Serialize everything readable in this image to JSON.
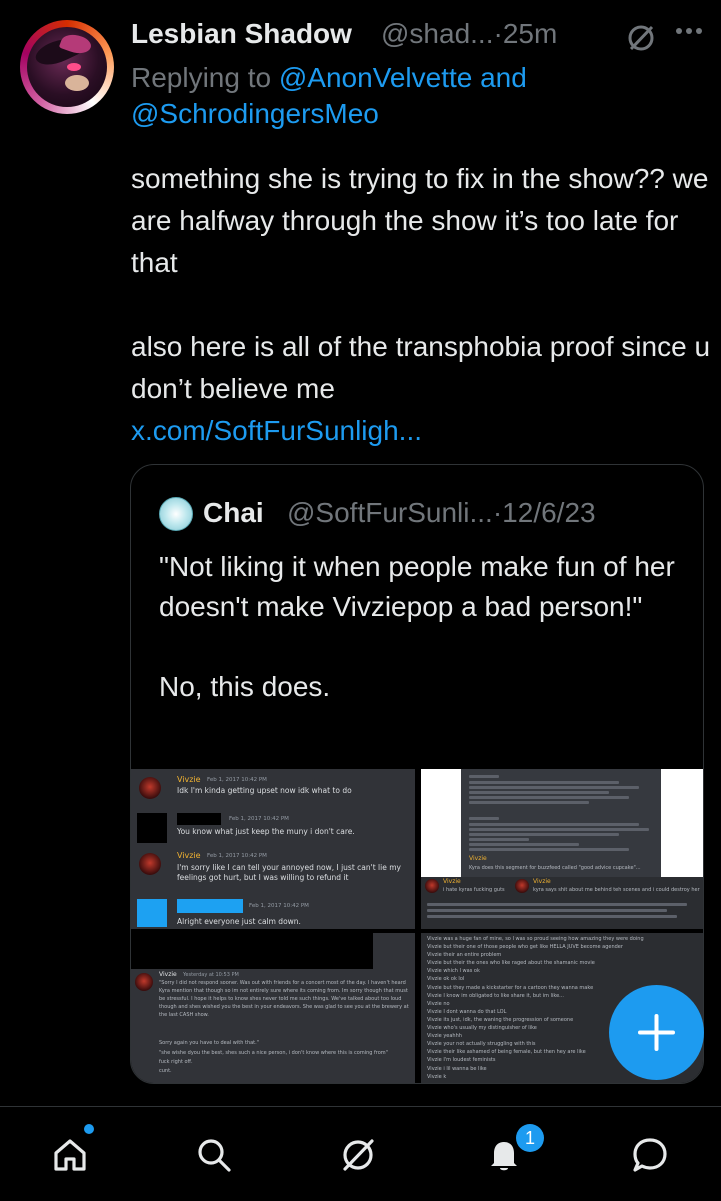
{
  "post": {
    "author_name": "Lesbian Shadow",
    "author_handle": "@shad...",
    "separator": "·",
    "time": "25m",
    "more_label": "···",
    "reply_prefix": "Replying to ",
    "reply_users": "@AnonVelvette and @SchrodingersMeo",
    "text_para1": "something she is trying to fix in the show?? we are halfway through the show it’s too late for that",
    "text_para2": "also here is all of the transphobia proof since u don’t believe me",
    "link": "x.com/SoftFurSunligh..."
  },
  "quote": {
    "author_name": "Chai",
    "author_handle": "@SoftFurSunli...",
    "separator": "·",
    "date": "12/6/23",
    "text_para1": "\"Not liking it when people make fun of her doesn't make Vivziepop a bad person!\"",
    "text_para2": "No, this does.",
    "images": {
      "img1": {
        "msg1_name": "Vivzie",
        "msg1_date": "Feb 1, 2017 10:42 PM",
        "msg1_text": "Idk I'm kinda getting upset now idk what to do",
        "msg2_date": "Feb 1, 2017 10:42 PM",
        "msg2_text": "You know what just keep the muny i don't care.",
        "msg3_name": "Vivzie",
        "msg3_date": "Feb 1, 2017 10:42 PM",
        "msg3_text": "I'm sorry like I can tell your annoyed now, I just can't lie my feelings got hurt, but I was willing to refund it",
        "msg4_date": "Feb 1, 2017 10:42 PM",
        "msg4_text": "Alright everyone just calm down."
      },
      "img2": {
        "name_a": "Vivzie",
        "text_a": "Kyra does this segment for buzzfeed called \"good advice cupcake\"...",
        "name_b": "Vivzie",
        "text_b": "i hate kyras fucking guts",
        "name_c": "Vivzie",
        "text_c": "kyra says shit about me behind teh scenes and i could destroy her"
      },
      "img3": {
        "name": "Vivzie",
        "date": "Yesterday at 10:53 PM",
        "text1": "\"Sorry I did not respond sooner. Was out with friends for a concert most of the day. I haven't heard Kyra mention that though so im not entirely sure where its coming from. Im sorry though that must be stressful. I hope it helps to know shes never told me such things. We've talked about too loud though and shes wished you the best in your endeavors. She was glad to see you at the brewery at the last CASH show.",
        "text2": "Sorry again you have to deal with that.\"",
        "text3": "\"she wishe dyou the best, shes such a nice person, i don't know where this is coming from\"",
        "text4": "fuck right off.",
        "text5": "cunt."
      },
      "img4": {
        "lines": [
          "Vivzie  was a huge fan of mine, so I was so proud seeing how amazing they were doing",
          "Vivzie  but their one of those people who get like HELLA JUVE become agender",
          "Vivzie  their an entire problem",
          "Vivzie  but their the ones who like raged about the shamanic movie",
          "Vivzie  which I was ok",
          "Vivzie  ok ok lol",
          "Vivzie  but they made a kickstarter for a cartoon they wanna make",
          "Vivzie  I know im obligated to like share it, but im like...",
          "Vivzie  no",
          "Vivzie  I dont wanna do that LOL",
          "Vivzie  its just, idk, the waning the progression of someone",
          "Vivzie  who's usually my distinguisher of like",
          "Vivzie  yeahhh",
          "Vivzie  your not actually struggling with this",
          "Vivzie  their like ashamed of being female, but then hey are like",
          "Vivzie  I'm loudest feminists",
          "Vivzie  i lil wanna be like",
          "Vivzie  k"
        ]
      }
    }
  },
  "fab": {
    "icon": "plus-icon"
  },
  "nav": {
    "items": [
      "home-icon",
      "search-icon",
      "grok-icon",
      "notifications-icon",
      "messages-icon"
    ],
    "notification_count": "1"
  },
  "colors": {
    "background": "#000000",
    "text": "#e7e9ea",
    "muted": "#71767b",
    "accent": "#1d9bf0",
    "border": "#2f3336"
  }
}
